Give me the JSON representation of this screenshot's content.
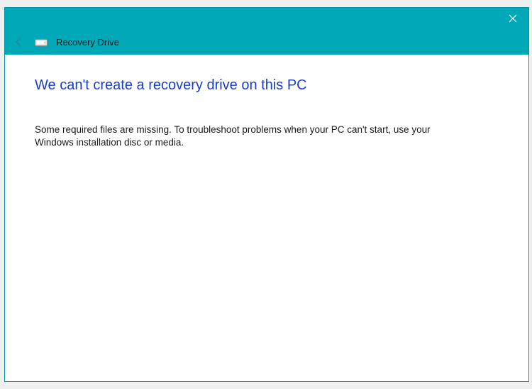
{
  "background_fragment": "",
  "header": {
    "title": "Recovery Drive"
  },
  "content": {
    "heading": "We can't create a recovery drive on this PC",
    "body": "Some required files are missing. To troubleshoot problems when your PC can't start, use your Windows installation disc or media."
  }
}
